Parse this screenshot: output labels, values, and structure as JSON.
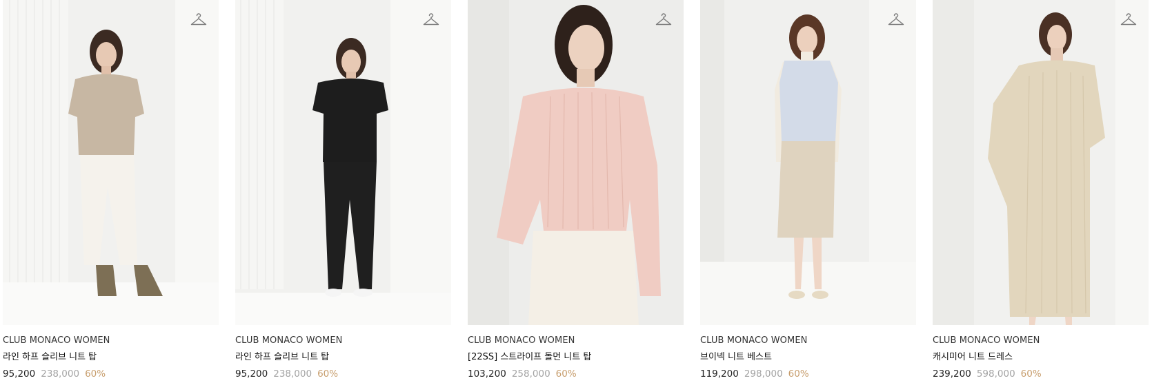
{
  "theme": {
    "accent_discount": "#c79d6c",
    "original_price_color": "#a3a3a3"
  },
  "products": [
    {
      "brand": "CLUB MONACO WOMEN",
      "name": "라인 하프 슬리브 니트 탑",
      "sale_price": "95,200",
      "original_price": "238,000",
      "discount": "60%",
      "icon": "hanger-icon"
    },
    {
      "brand": "CLUB MONACO WOMEN",
      "name": "라인 하프 슬리브 니트 탑",
      "sale_price": "95,200",
      "original_price": "238,000",
      "discount": "60%",
      "icon": "hanger-icon"
    },
    {
      "brand": "CLUB MONACO WOMEN",
      "name": "[22SS] 스트라이프 돌먼 니트 탑",
      "sale_price": "103,200",
      "original_price": "258,000",
      "discount": "60%",
      "icon": "hanger-icon"
    },
    {
      "brand": "CLUB MONACO WOMEN",
      "name": "브이넥 니트 베스트",
      "sale_price": "119,200",
      "original_price": "298,000",
      "discount": "60%",
      "icon": "hanger-icon"
    },
    {
      "brand": "CLUB MONACO WOMEN",
      "name": "캐시미어 니트 드레스",
      "sale_price": "239,200",
      "original_price": "598,000",
      "discount": "60%",
      "icon": "hanger-icon"
    }
  ]
}
